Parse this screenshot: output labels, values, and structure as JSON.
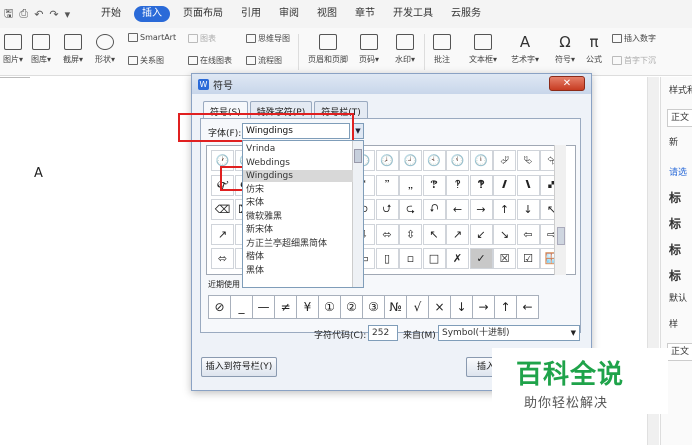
{
  "menu": {
    "items": [
      "开始",
      "插入",
      "页面布局",
      "引用",
      "审阅",
      "视图",
      "章节",
      "开发工具",
      "云服务"
    ],
    "active_index": 1
  },
  "ribbon": {
    "buttons": [
      "图片▾",
      "图库▾",
      "截屏▾",
      "形状▾",
      "页眉和页脚",
      "页码▾",
      "水印▾",
      "批注",
      "文本框▾",
      "艺术字▾",
      "符号▾",
      "公式"
    ],
    "small": {
      "smartart": "SmartArt",
      "chart": "图表",
      "mindmap": "思维导图",
      "relation": "关系图",
      "online_chart": "在线图表",
      "flowchart": "流程图",
      "insert_number": "插入数字",
      "first_drop": "首字下沉"
    }
  },
  "document": {
    "text": "A"
  },
  "right_panel": {
    "labels": [
      "样式和",
      "正文",
      "新",
      "请选",
      "标",
      "标",
      "标",
      "标",
      "默认",
      "样",
      "正文"
    ]
  },
  "dialog": {
    "title": "符号",
    "close_label": "✕",
    "tabs": [
      "符号(S)",
      "特殊字符(P)",
      "符号栏(T)"
    ],
    "font_label": "字体(F):",
    "font_value": "Wingdings",
    "font_options": [
      "Vrinda",
      "Webdings",
      "Wingdings",
      "仿宋",
      "宋体",
      "微软雅黑",
      "新宋体",
      "方正兰亭超细黑简体",
      "楷体",
      "黑体"
    ],
    "font_selected_index": 2,
    "grid_symbols": [
      [
        "🕐",
        "🕑",
        "🕒",
        "🕓",
        "🕔",
        "🕕",
        "🕖",
        "🕗",
        "🕘",
        "🕙",
        "🕚",
        "🕛",
        "⮰",
        "⮱",
        "⮲"
      ],
      [
        "🙰",
        "🙱",
        "🙲",
        "🙳",
        "🙴",
        "🙵",
        "🙶",
        "🙷",
        "🙸",
        "🙹",
        "🙺",
        "🙻",
        "🙼",
        "🙽",
        "🙾"
      ],
      [
        "⌫",
        "⌦",
        "🙿",
        "🙾",
        "🙽",
        "🙼",
        "⮌",
        "⮍",
        "⮎",
        "⮏",
        "←",
        "→",
        "↑",
        "↓",
        "↖"
      ],
      [
        "↗",
        "↙",
        "↘",
        "⇦",
        "⇨",
        "⇧",
        "⇩",
        "⬄",
        "⇳",
        "↖",
        "↗",
        "↙",
        "↘",
        "⇦",
        "⇨"
      ],
      [
        "⬄",
        "⇳",
        "⬀",
        "⬁",
        "⬂",
        "⬃",
        "▭",
        "▯",
        "▫",
        "□",
        "✗",
        "✓",
        "☒",
        "☑",
        "🪟"
      ]
    ],
    "selected_cell": [
      4,
      11
    ],
    "recent_label": "近期使用",
    "recent_symbols": [
      "⊘",
      "_",
      "—",
      "≠",
      "¥",
      "①",
      "②",
      "③",
      "№",
      "√",
      "×",
      "↓",
      "→",
      "↑",
      "←"
    ],
    "code_label": "字符代码(C):",
    "code_value": "252",
    "from_label": "来自(M)",
    "from_value": "Symbol(十进制)",
    "insert_toolbar_button": "插入到符号栏(Y)",
    "insert_button": "插入"
  },
  "watermark": {
    "main": "百科全说",
    "sub": "助你轻松解决"
  },
  "colors": {
    "accent": "#2a6ad8",
    "highlight": "#e02020",
    "watermark": "#1fa34a"
  }
}
